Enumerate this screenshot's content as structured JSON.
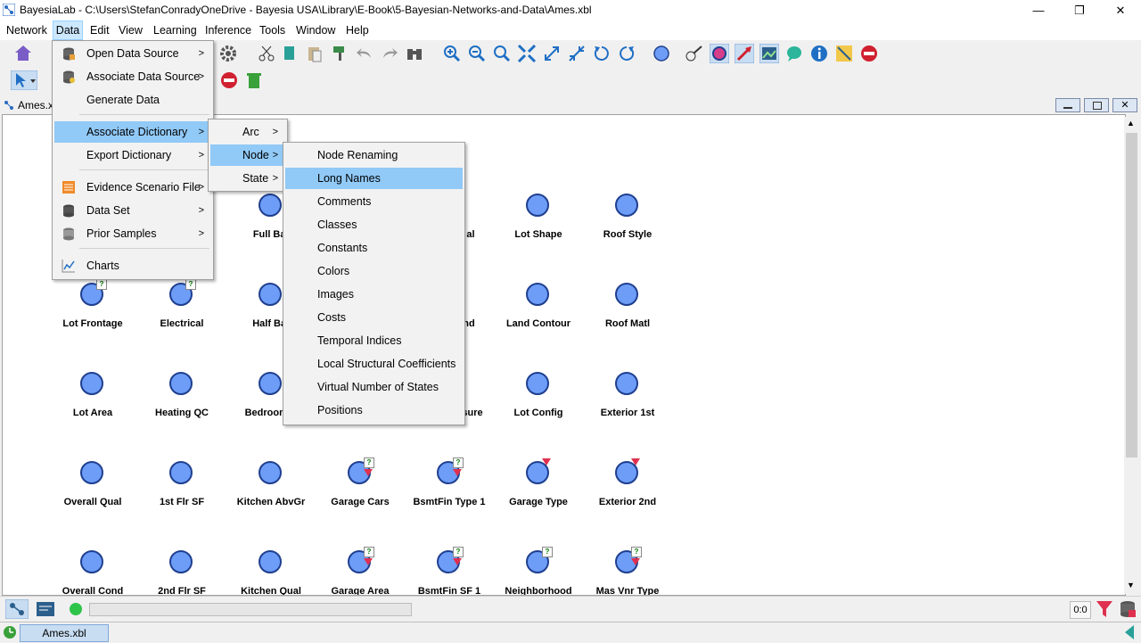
{
  "window": {
    "title": "BayesiaLab - C:\\Users\\StefanConradyOneDrive - Bayesia USA\\Library\\E-Book\\5-Bayesian-Networks-and-Data\\Ames.xbl",
    "minimize": "—",
    "maximize": "❐",
    "close": "✕"
  },
  "menubar": [
    "Network",
    "Data",
    "Edit",
    "View",
    "Learning",
    "Inference",
    "Tools",
    "Window",
    "Help"
  ],
  "document": {
    "tab_label": "Ames.xbl"
  },
  "data_menu": {
    "items": [
      {
        "label": "Open Data Source",
        "submenu": true,
        "icon": "database-open-icon"
      },
      {
        "label": "Associate Data Source",
        "submenu": true,
        "icon": "database-associate-icon"
      },
      {
        "label": "Generate Data",
        "submenu": false,
        "icon": ""
      },
      {
        "label": "Associate Dictionary",
        "submenu": true,
        "icon": ""
      },
      {
        "label": "Export Dictionary",
        "submenu": true,
        "icon": ""
      },
      {
        "label": "Evidence Scenario File",
        "submenu": true,
        "icon": "scenario-file-icon"
      },
      {
        "label": "Data Set",
        "submenu": true,
        "icon": "dataset-icon"
      },
      {
        "label": "Prior Samples",
        "submenu": true,
        "icon": "prior-samples-icon"
      },
      {
        "label": "Charts",
        "submenu": false,
        "icon": "charts-icon"
      }
    ]
  },
  "dictionary_submenu": [
    "Arc",
    "Node",
    "State"
  ],
  "node_submenu": [
    "Node Renaming",
    "Long Names",
    "Comments",
    "Classes",
    "Constants",
    "Colors",
    "Images",
    "Costs",
    "Temporal Indices",
    "Local Structural Coefficients",
    "Virtual Number of States",
    "Positions"
  ],
  "nodes": {
    "full_bath": "Full Bat",
    "partial_r1": "al",
    "lot_shape": "Lot Shape",
    "roof_style": "Roof Style",
    "lot_frontage": "Lot Frontage",
    "electrical": "Electrical",
    "half_bath": "Half Bat",
    "partial_r2": "nd",
    "land_contour": "Land Contour",
    "roof_matl": "Roof Matl",
    "lot_area": "Lot Area",
    "heating_qc": "Heating QC",
    "bedroom": "Bedroom A",
    "partial_r3": "sure",
    "lot_config": "Lot Config",
    "exterior_1st": "Exterior 1st",
    "overall_qual": "Overall Qual",
    "first_flr_sf": "1st Flr SF",
    "kitchen_abvgr": "Kitchen AbvGr",
    "garage_cars": "Garage Cars",
    "bsmtfin_type_1": "BsmtFin Type 1",
    "garage_type": "Garage Type",
    "exterior_2nd": "Exterior 2nd",
    "overall_cond": "Overall Cond",
    "second_flr_sf": "2nd Flr SF",
    "kitchen_qual": "Kitchen Qual",
    "garage_area": "Garage Area",
    "bsmtfin_sf_1": "BsmtFin SF 1",
    "neighborhood": "Neighborhood",
    "mas_vnr_type": "Mas Vnr Type"
  },
  "statusbar": {
    "counter": "0:0"
  },
  "taskbar": {
    "item": "Ames.xbl"
  }
}
